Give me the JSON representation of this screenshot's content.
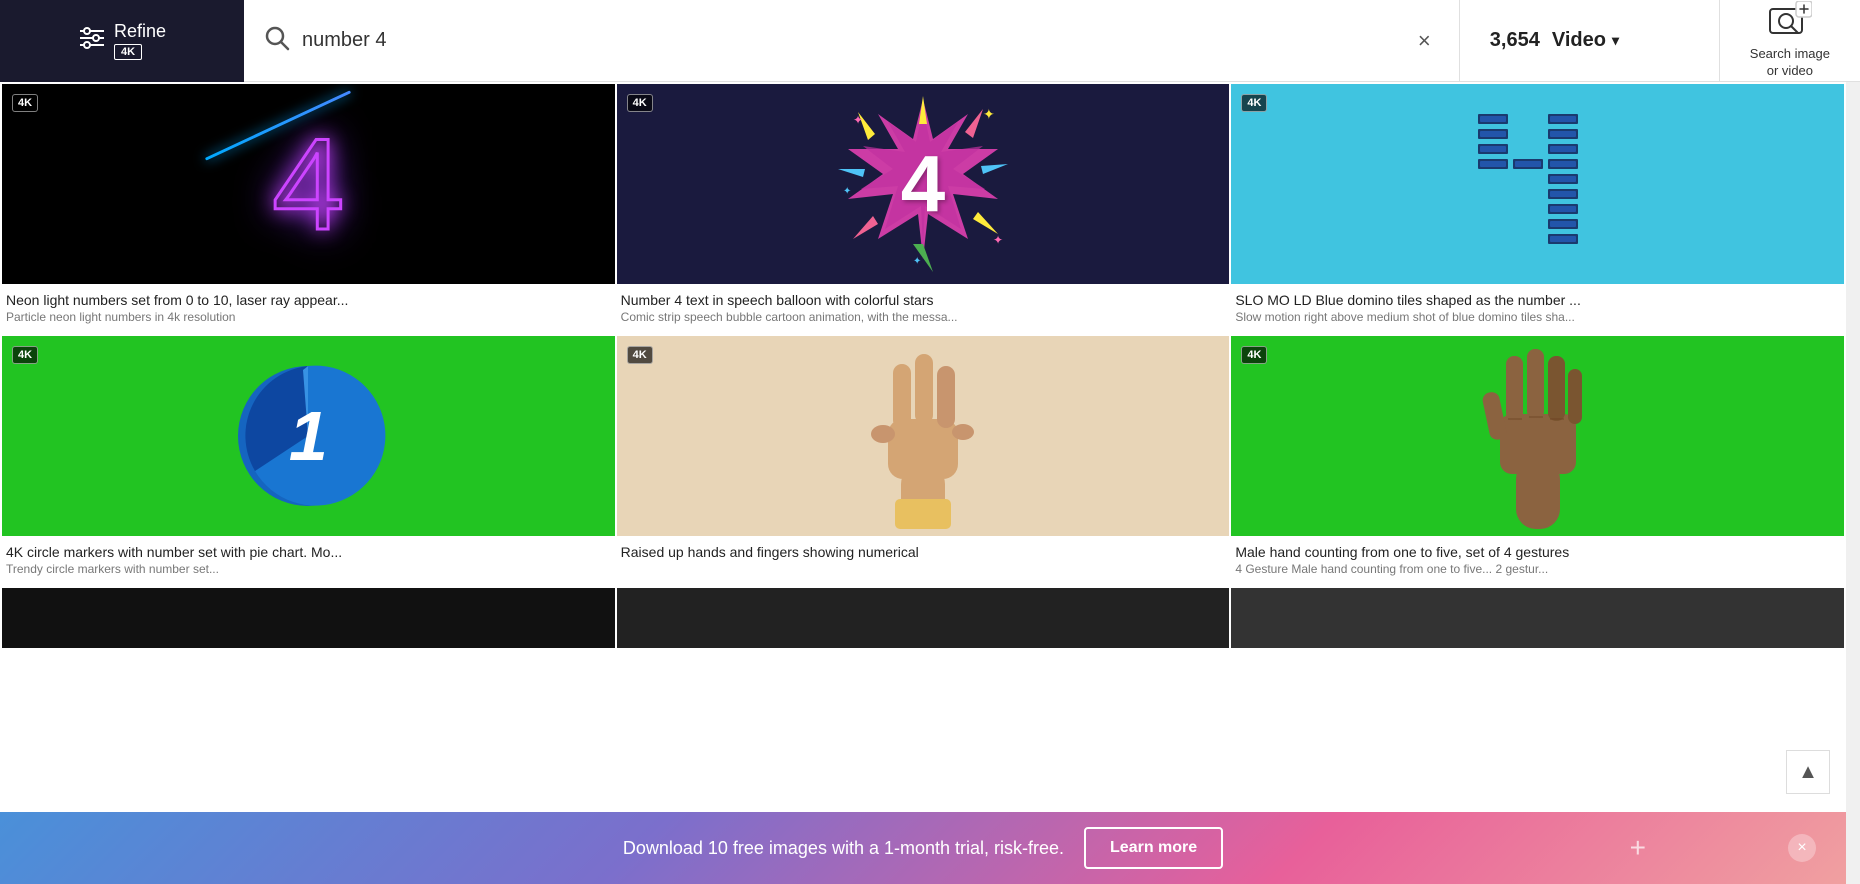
{
  "header": {
    "refine_label": "Refine",
    "refine_4k": "4K",
    "search_value": "number 4",
    "results_count": "3,654",
    "video_label": "Video",
    "search_image_label": "Search image\nor video",
    "clear_button": "×"
  },
  "grid": {
    "items": [
      {
        "id": 1,
        "badge": "4K",
        "title": "Neon light numbers set from 0 to 10, laser ray appear...",
        "subtitle": "Particle neon light numbers in 4k resolution",
        "has_badge": true
      },
      {
        "id": 2,
        "badge": "4K",
        "title": "Number 4 text in speech balloon with colorful stars",
        "subtitle": "Comic strip speech bubble cartoon animation, with the messa...",
        "has_badge": true
      },
      {
        "id": 3,
        "badge": "4K",
        "title": "SLO MO LD Blue domino tiles shaped as the number ...",
        "subtitle": "Slow motion right above medium shot of blue domino tiles sha...",
        "has_badge": true
      },
      {
        "id": 4,
        "badge": "4K",
        "title": "4K circle markers with number set with pie chart. Mo...",
        "subtitle": "Trendy circle markers with number set...",
        "has_badge": true
      },
      {
        "id": 5,
        "badge": "4K",
        "title": "Raised up hands and fingers showing numerical",
        "subtitle": "",
        "has_badge": true
      },
      {
        "id": 6,
        "badge": "4K",
        "title": "Male hand counting from one to five, set of 4 gestures",
        "subtitle": "4 Gesture Male hand counting from one to five... 2 gestur...",
        "has_badge": true
      }
    ]
  },
  "banner": {
    "text": "Download 10 free images with a 1-month trial, risk-free.",
    "learn_more": "Learn more",
    "close": "×"
  },
  "scroll_top": "▲"
}
